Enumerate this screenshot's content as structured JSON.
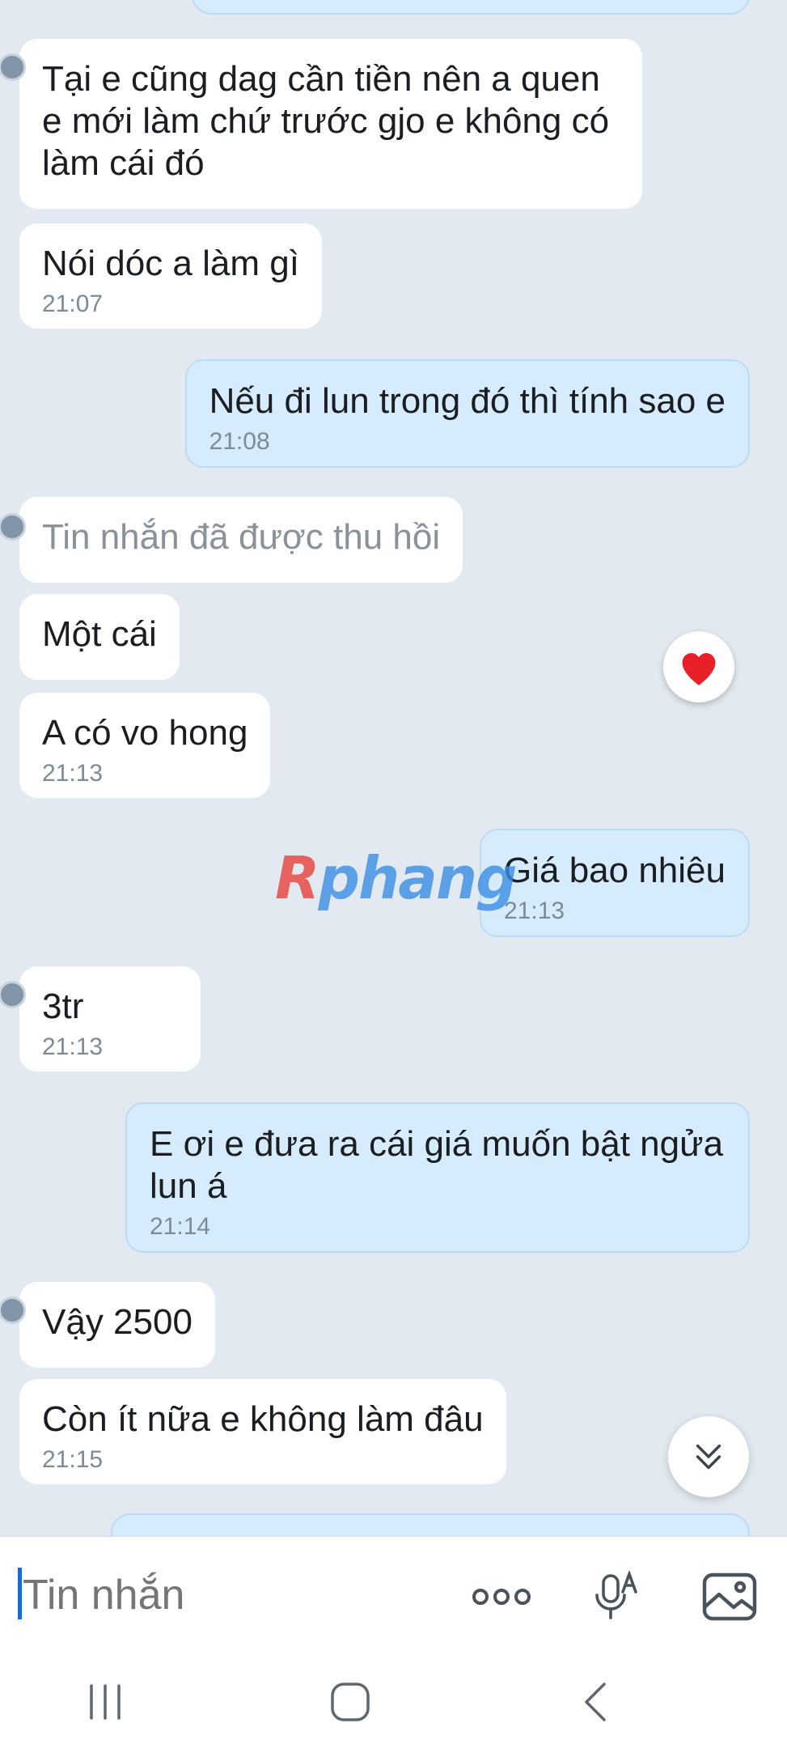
{
  "messages": [
    {
      "id": "m1",
      "side": "in",
      "text": "Tại e cũng dag cần tiền nên a quen e mới làm chứ trước gjo e không có làm cái đó",
      "time": ""
    },
    {
      "id": "m2",
      "side": "in",
      "text": "Nói dóc a làm gì",
      "time": "21:07"
    },
    {
      "id": "m3",
      "side": "out",
      "text": "Nếu đi lun trong đó thì tính sao e",
      "time": "21:08"
    },
    {
      "id": "m4",
      "side": "in",
      "text": "Tin nhắn đã được thu hồi",
      "time": "",
      "recalled": true
    },
    {
      "id": "m5",
      "side": "in",
      "text": "Một cái",
      "time": ""
    },
    {
      "id": "m6",
      "side": "in",
      "text": "A có vo hong",
      "time": "21:13"
    },
    {
      "id": "m7",
      "side": "out",
      "text": "Giá bao nhiêu",
      "time": "21:13"
    },
    {
      "id": "m8",
      "side": "in",
      "text": "3tr",
      "time": "21:13"
    },
    {
      "id": "m9",
      "side": "out",
      "text": "E ơi e đưa ra cái giá muốn bật ngửa lun á",
      "time": "21:14"
    },
    {
      "id": "m10",
      "side": "in",
      "text": "Vậy 2500",
      "time": ""
    },
    {
      "id": "m11",
      "side": "in",
      "text": "Còn ít nữa e không làm đâu",
      "time": "21:15"
    }
  ],
  "reaction": {
    "icon": "heart-icon",
    "color": "#e8202a"
  },
  "watermark": {
    "first": "R",
    "rest": "phang"
  },
  "composer": {
    "placeholder": "Tin nhắn",
    "icons": [
      "more-icon",
      "voice-to-text-icon",
      "image-icon"
    ]
  },
  "navbar": {
    "icons": [
      "recent-apps-icon",
      "home-icon",
      "back-icon"
    ]
  },
  "colors": {
    "background": "#e2e9f0",
    "incoming_bubble": "#ffffff",
    "outgoing_bubble": "#d6ecfd",
    "accent": "#0f6fde"
  }
}
